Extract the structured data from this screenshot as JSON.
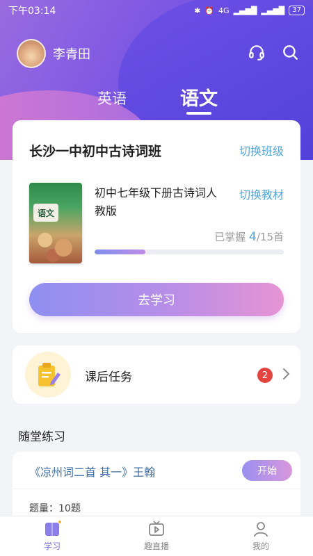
{
  "status_bar": {
    "time": "下午03:14",
    "network": "4G",
    "battery": "37"
  },
  "header": {
    "user_name": "李青田",
    "icons": [
      "headset-icon",
      "search-icon"
    ]
  },
  "subject_tabs": [
    {
      "label": "英语",
      "active": false
    },
    {
      "label": "语文",
      "active": true
    }
  ],
  "class_card": {
    "class_name": "长沙一中初中古诗词班",
    "switch_class": "切换班级",
    "book_cover_text": "语文",
    "book_title": "初中七年级下册古诗词人教版",
    "switch_book": "切换教材",
    "mastered_label": "已掌握",
    "mastered_count": "4",
    "mastered_total": "/15首",
    "progress_fraction": 0.2667,
    "study_button": "去学习"
  },
  "task_card": {
    "label": "课后任务",
    "badge_count": "2"
  },
  "practice": {
    "section_title": "随堂练习",
    "poem_title": "《凉州词二首 其一》王翰",
    "start_button": "开始",
    "question_count": "题量：10题"
  },
  "bottom_nav": [
    {
      "label": "学习",
      "icon": "book-icon",
      "active": true
    },
    {
      "label": "趣直播",
      "icon": "tv-play-icon",
      "active": false
    },
    {
      "label": "我的",
      "icon": "profile-icon",
      "active": false
    }
  ],
  "colors": {
    "accent": "#7a6fe0",
    "link": "#4fa6d8",
    "badge": "#e5433f"
  }
}
